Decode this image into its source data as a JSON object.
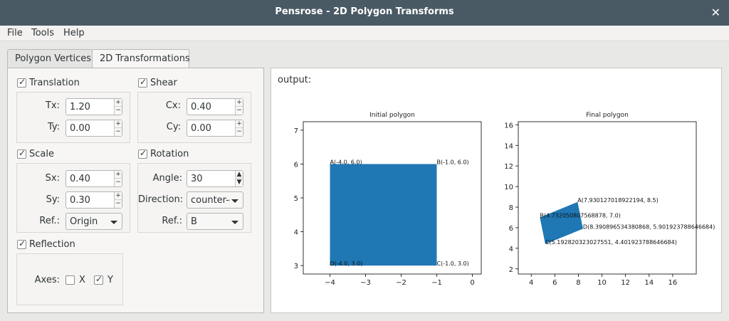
{
  "window": {
    "title": "Pensrose - 2D Polygon Transforms",
    "close_glyph": "✕"
  },
  "menu": {
    "file": "File",
    "tools": "Tools",
    "help": "Help"
  },
  "tabs": {
    "vertices": "Polygon Vertices",
    "transforms": "2D Transformations"
  },
  "translation": {
    "label": "Translation",
    "checked": true,
    "tx_label": "Tx:",
    "tx": "1.20",
    "ty_label": "Ty:",
    "ty": "0.00"
  },
  "shear": {
    "label": "Shear",
    "checked": true,
    "cx_label": "Cx:",
    "cx": "0.40",
    "cy_label": "Cy:",
    "cy": "0.00"
  },
  "scale": {
    "label": "Scale",
    "checked": true,
    "sx_label": "Sx:",
    "sx": "0.40",
    "sy_label": "Sy:",
    "sy": "0.30",
    "ref_label": "Ref.:",
    "ref": "Origin"
  },
  "rotation": {
    "label": "Rotation",
    "checked": true,
    "angle_label": "Angle:",
    "angle": "30",
    "direction_label": "Direction:",
    "direction": "counter-clockwise",
    "ref_label": "Ref.:",
    "ref": "B"
  },
  "reflection": {
    "label": "Reflection",
    "checked": true,
    "axes_label": "Axes:",
    "x_label": "X",
    "x_checked": false,
    "y_label": "Y",
    "y_checked": true
  },
  "output": {
    "label": "output:"
  },
  "colors": {
    "polygon": "#1f77b4",
    "titlebar": "#4a5a65"
  },
  "chart_data": [
    {
      "type": "polygon",
      "title": "Initial polygon",
      "xlim": [
        -4.75,
        0.25
      ],
      "ylim": [
        2.75,
        7.25
      ],
      "xticks": [
        -4,
        -3,
        -2,
        -1,
        0
      ],
      "yticks": [
        3,
        4,
        5,
        6,
        7
      ],
      "vertices": [
        {
          "name": "A",
          "x": -4.0,
          "y": 6.0,
          "label": "A(-4.0, 6.0)"
        },
        {
          "name": "B",
          "x": -1.0,
          "y": 6.0,
          "label": "B(-1.0, 6.0)"
        },
        {
          "name": "C",
          "x": -1.0,
          "y": 3.0,
          "label": "C(-1.0, 3.0)"
        },
        {
          "name": "D",
          "x": -4.0,
          "y": 3.0,
          "label": "D(-4.0, 3.0)"
        }
      ]
    },
    {
      "type": "polygon",
      "title": "Final polygon",
      "xlim": [
        2.9,
        18.0
      ],
      "ylim": [
        1.5,
        16.3
      ],
      "xticks": [
        4,
        6,
        8,
        10,
        12,
        14,
        16
      ],
      "yticks": [
        2,
        4,
        6,
        8,
        10,
        12,
        14,
        16
      ],
      "vertices": [
        {
          "name": "A",
          "x": 7.930127018922194,
          "y": 8.5,
          "label": "A(7.930127018922194, 8.5)"
        },
        {
          "name": "B",
          "x": 4.732050807568878,
          "y": 7.0,
          "label": "B(4.732050807568878, 7.0)"
        },
        {
          "name": "C",
          "x": 5.192820323027551,
          "y": 4.401923788646684,
          "label": "C(5.192820323027551, 4.401923788646684)"
        },
        {
          "name": "D",
          "x": 8.390896534380868,
          "y": 5.901923788646684,
          "label": "D(8.390896534380868, 5.901923788646684)"
        }
      ]
    }
  ]
}
